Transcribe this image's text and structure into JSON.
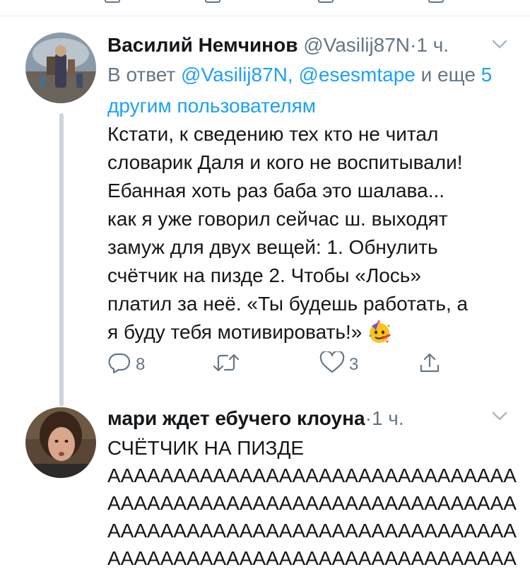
{
  "tweets": [
    {
      "author": {
        "name": "Василий Немчинов",
        "handle": "@Vasilij87N"
      },
      "separator": "·",
      "time": "1 ч.",
      "reply_to": {
        "prefix": "В ответ",
        "mention1": "@Vasilij87N,",
        "mention2": "@esesmtape",
        "conjunction": "и еще",
        "others": "5 другим пользователям"
      },
      "lines": [
        "Кстати, к сведению тех кто не читал",
        "словарик Даля и кого не воспитывали!",
        "Ебанная хоть раз баба это шалава...",
        "как я уже говорил сейчас ш. выходят",
        "замуж для двух вещей: 1. Обнулить",
        "счётчик на пизде 2. Чтобы «Лось»",
        "платил за неё. «Ты будешь работать, а",
        "я буду тебя мотивировать!»"
      ],
      "emoji_icon": "partying-face-emoji",
      "actions": {
        "reply_count": "8",
        "retweet_count": "",
        "like_count": "3"
      }
    },
    {
      "author": {
        "name": "мари ждет ебучего клоуна"
      },
      "separator": "·",
      "time": "1 ч.",
      "lines": [
        "СЧЁТЧИК НА ПИЗДЕ",
        "ААААААААААААААААААААААААААААААА",
        "ААААААААААААААААААААААААААААААА",
        "ААААААААААААААААААААААААААААААА",
        "ААААААААААААААААААААААААААААААА"
      ]
    }
  ],
  "colors": {
    "text": "#14171a",
    "secondary": "#657786",
    "link": "#1da1f2",
    "divider": "#e6ecf0",
    "thread_line": "#ccd6dd"
  }
}
